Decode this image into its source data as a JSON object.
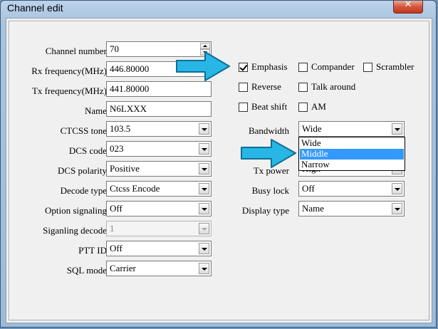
{
  "window": {
    "title": "Channel edit",
    "close_glyph": "✕"
  },
  "left_fields": {
    "channel_number": {
      "label": "Channel number",
      "value": "70"
    },
    "rx_frequency": {
      "label": "Rx frequency(MHz)",
      "value": "446.80000"
    },
    "tx_frequency": {
      "label": "Tx frequency(MHz)",
      "value": "441.80000"
    },
    "name": {
      "label": "Name",
      "value": "N6LXXX"
    },
    "ctcss_tone": {
      "label": "CTCSS tone",
      "value": "103.5"
    },
    "dcs_code": {
      "label": "DCS code",
      "value": "023"
    },
    "dcs_polarity": {
      "label": "DCS polarity",
      "value": "Positive"
    },
    "decode_type": {
      "label": "Decode type",
      "value": "Ctcss Encode"
    },
    "option_signaling": {
      "label": "Option signaling",
      "value": "Off"
    },
    "signaling_decode": {
      "label": "Siganling decode",
      "value": "1"
    },
    "ptt_id": {
      "label": "PTT ID",
      "value": "Off"
    },
    "sql_mode": {
      "label": "SQL mode",
      "value": "Carrier"
    }
  },
  "checkboxes": {
    "emphasis": {
      "label": "Emphasis",
      "checked": true
    },
    "compander": {
      "label": "Compander",
      "checked": false
    },
    "scrambler": {
      "label": "Scrambler",
      "checked": false
    },
    "reverse": {
      "label": "Reverse",
      "checked": false
    },
    "talk_around": {
      "label": "Talk around",
      "checked": false
    },
    "beat_shift": {
      "label": "Beat shift",
      "checked": false
    },
    "am": {
      "label": "AM",
      "checked": false
    }
  },
  "right_fields": {
    "bandwidth": {
      "label": "Bandwidth",
      "value": "Wide",
      "options": [
        "Wide",
        "Middle",
        "Narrow"
      ],
      "highlighted": "Middle"
    },
    "tx_power": {
      "label": "Tx power",
      "value": "High"
    },
    "busy_lock": {
      "label": "Busy lock",
      "value": "Off"
    },
    "display_type": {
      "label": "Display type",
      "value": "Name"
    }
  },
  "colors": {
    "arrow": "#27b6e6",
    "highlight": "#3399ff"
  },
  "icons": [
    "close-icon",
    "dropdown-arrow-icon",
    "spin-up-icon",
    "spin-down-icon",
    "checkmark-icon",
    "callout-arrow-icon"
  ]
}
